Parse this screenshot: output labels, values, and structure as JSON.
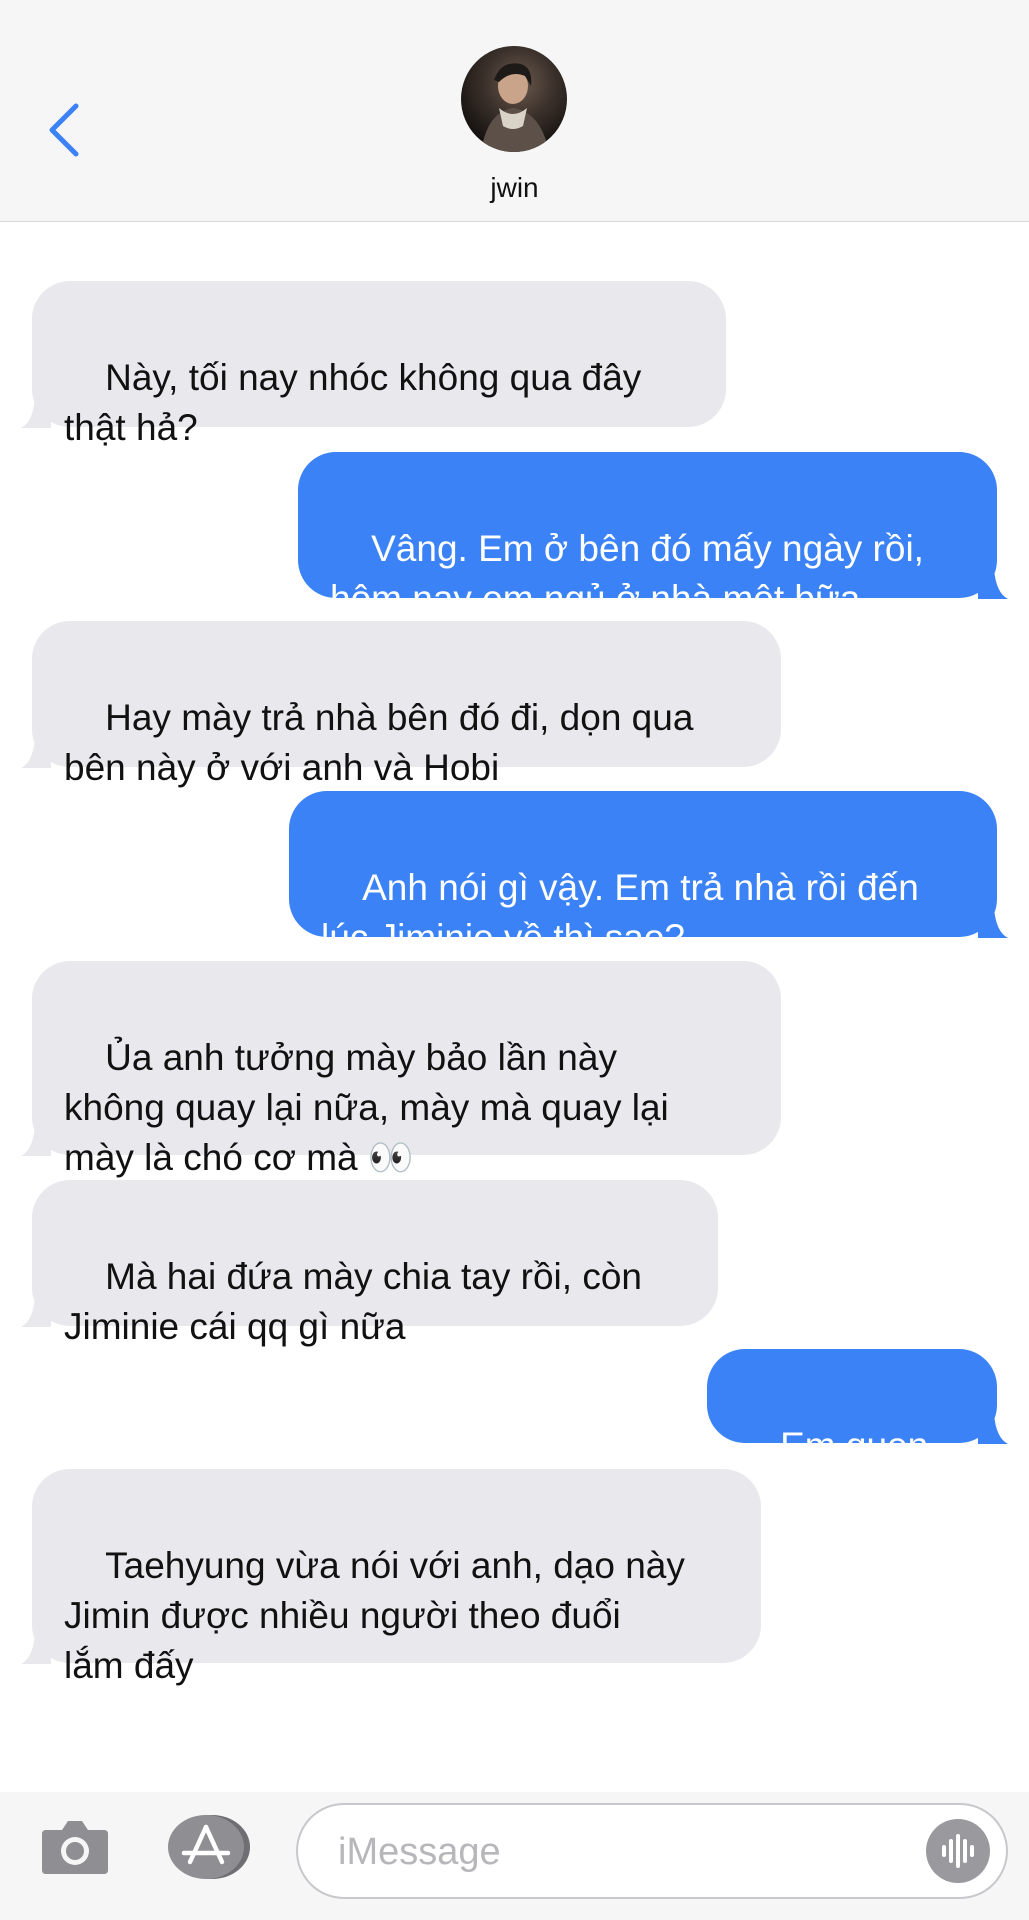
{
  "header": {
    "contact_name": "jwin",
    "accent_color": "#3a82f6"
  },
  "messages": [
    {
      "direction": "incoming",
      "text": "Này, tối nay nhóc không qua đây\nthật hả?"
    },
    {
      "direction": "outgoing",
      "text": "Vâng. Em ở bên đó mấy ngày rồi,\nhôm nay em ngủ ở nhà một bữa"
    },
    {
      "direction": "incoming",
      "text": "Hay mày trả nhà bên đó đi, dọn qua\nbên này ở với anh và Hobi"
    },
    {
      "direction": "outgoing",
      "text": "Anh nói gì vậy. Em trả nhà rồi đến\nlúc Jiminie về thì sao?"
    },
    {
      "direction": "incoming",
      "text": "Ủa anh tưởng mày bảo lần này\nkhông quay lại nữa, mày mà quay lại\nmày là chó cơ mà 👀"
    },
    {
      "direction": "incoming",
      "text": "Mà hai đứa mày chia tay rồi, còn\nJiminie cái qq gì nữa"
    },
    {
      "direction": "outgoing",
      "text": "Em quen rồi"
    },
    {
      "direction": "incoming",
      "text": "Taehyung vừa nói với anh, dạo này\nJimin được nhiều người theo đuổi\nlắm đấy"
    }
  ],
  "composer": {
    "placeholder": "iMessage"
  },
  "colors": {
    "incoming_bubble": "#e8e8ed",
    "outgoing_bubble": "#3a82f6",
    "header_background": "#f6f6f6"
  },
  "icons": [
    "chevron-left-icon",
    "camera-icon",
    "app-store-icon",
    "waveform-icon"
  ]
}
